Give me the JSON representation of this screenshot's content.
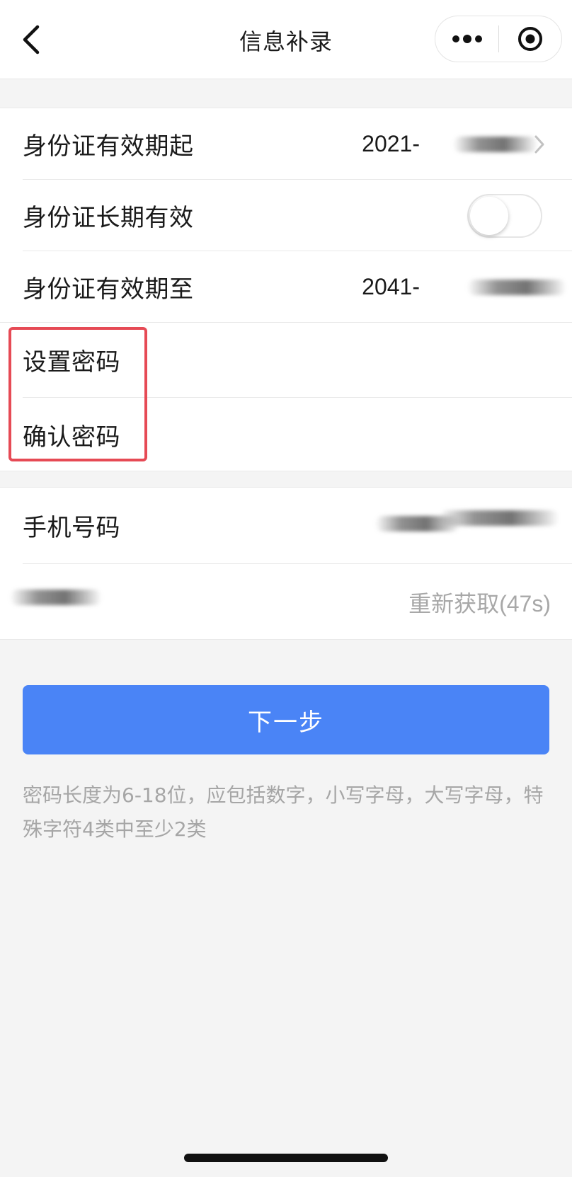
{
  "header": {
    "title": "信息补录",
    "back_icon": "chevron-left-icon",
    "more_icon": "more-dots-icon",
    "close_icon": "target-circle-icon"
  },
  "form": {
    "id_valid_from": {
      "label": "身份证有效期起",
      "value": "2021-"
    },
    "id_long_term": {
      "label": "身份证长期有效",
      "enabled": false
    },
    "id_valid_to": {
      "label": "身份证有效期至",
      "value": "2041-"
    },
    "set_password": {
      "label": "设置密码",
      "value": ""
    },
    "confirm_password": {
      "label": "确认密码",
      "value": ""
    }
  },
  "phone": {
    "label": "手机号码",
    "resend_label": "重新获取(47s)"
  },
  "next_button": {
    "label": "下一步"
  },
  "hint": "密码长度为6-18位，应包括数字，小写字母，大写字母，特殊字符4类中至少2类",
  "colors": {
    "primary": "#4a84f6",
    "highlight": "#e64a55",
    "muted_text": "#a6a6a6",
    "background": "#f4f4f4"
  }
}
